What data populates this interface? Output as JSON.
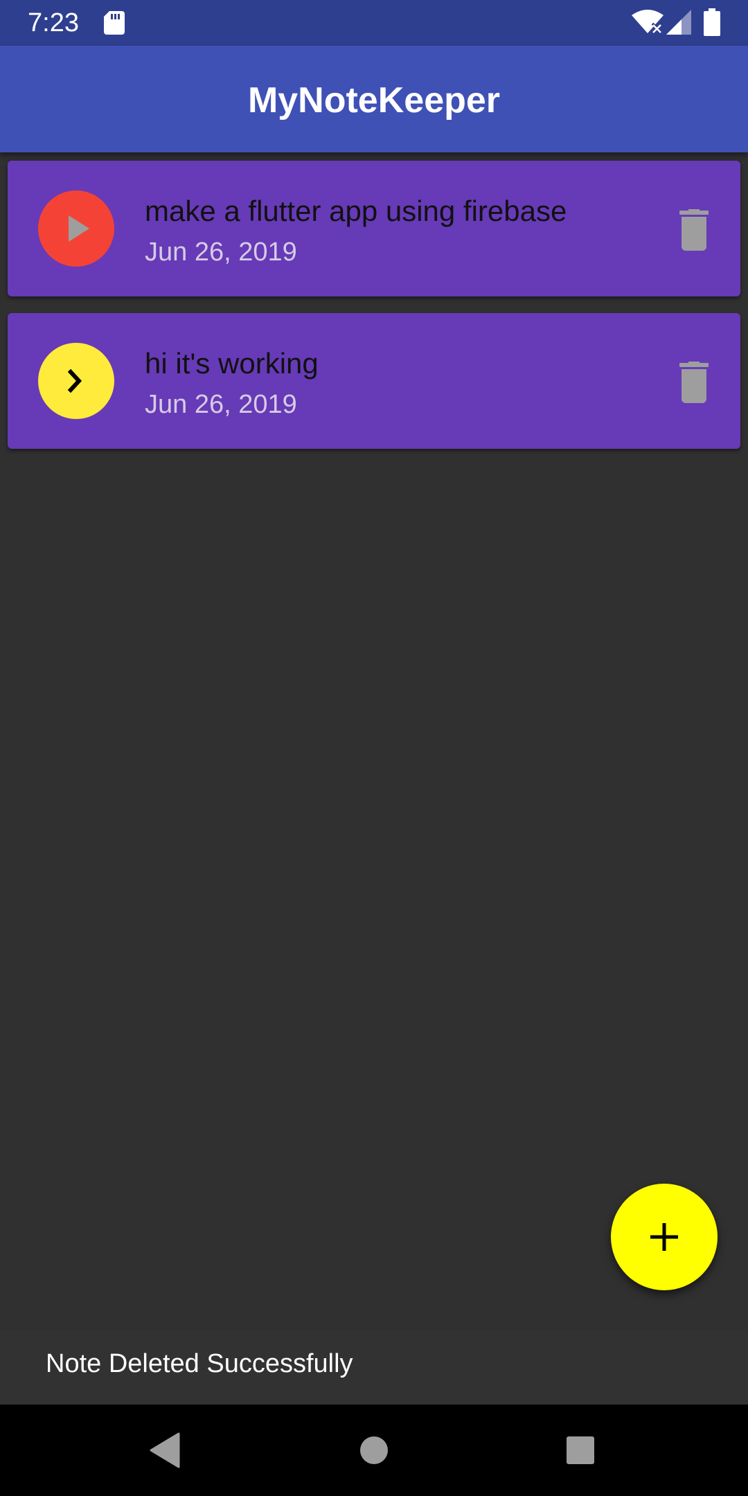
{
  "status_bar": {
    "time": "7:23",
    "icons": [
      "sd-card-icon",
      "wifi-icon",
      "signal-icon",
      "battery-icon"
    ]
  },
  "app_bar": {
    "title": "MyNoteKeeper"
  },
  "notes": [
    {
      "title": "make a flutter app using firebase",
      "date": "Jun 26, 2019",
      "priority_icon": "play-arrow-icon",
      "avatar_color": "#f44336"
    },
    {
      "title": "hi it's working",
      "date": "Jun 26, 2019",
      "priority_icon": "chevron-right-icon",
      "avatar_color": "#ffeb3b"
    }
  ],
  "fab": {
    "icon": "add-icon",
    "color": "#ffff00"
  },
  "snackbar": {
    "message": "Note Deleted Successfully"
  },
  "colors": {
    "status_bar": "#2f3f8f",
    "app_bar": "#3f51b5",
    "card": "#673ab7",
    "background": "#303030"
  }
}
